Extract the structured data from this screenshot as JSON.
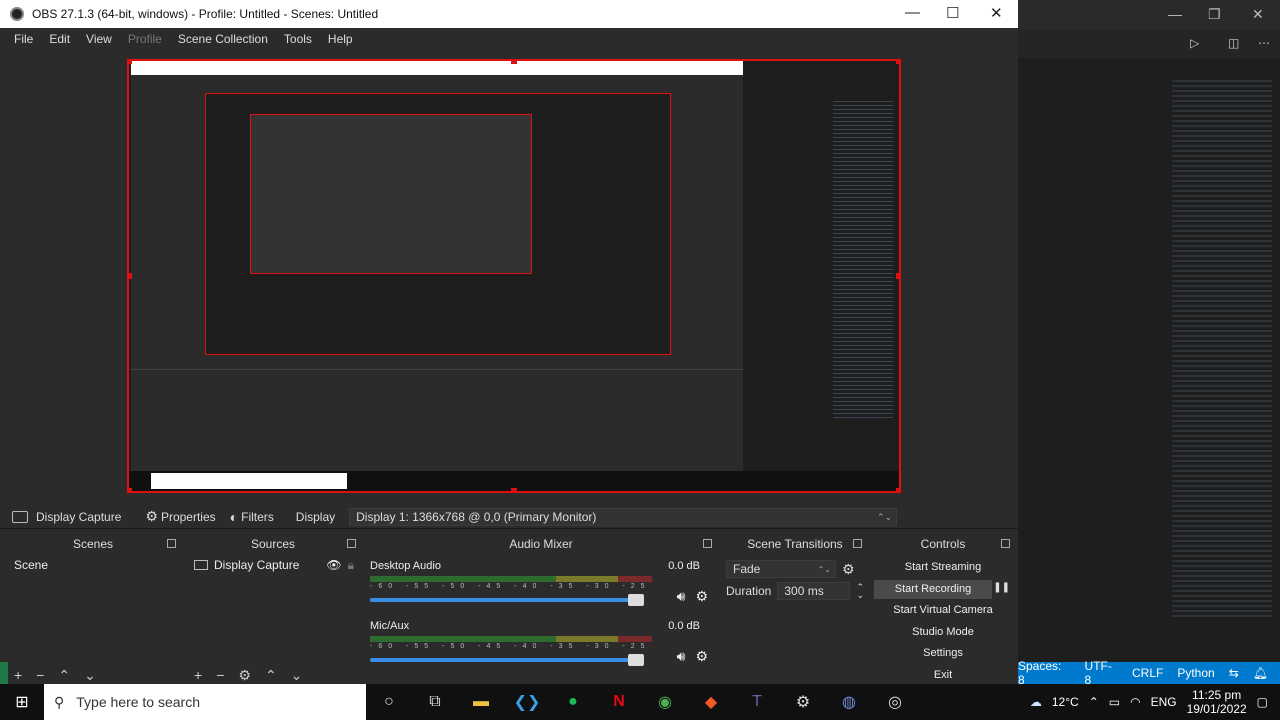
{
  "window": {
    "title": "OBS 27.1.3 (64-bit, windows) - Profile: Untitled - Scenes: Untitled"
  },
  "menu": [
    "File",
    "Edit",
    "View",
    "Profile",
    "Scene Collection",
    "Tools",
    "Help"
  ],
  "source_toolbar": {
    "source_name": "Display Capture",
    "properties": "Properties",
    "filters": "Filters",
    "display_label": "Display",
    "display_value": "Display 1: 1366x768 @ 0,0 (Primary Monitor)"
  },
  "scenes": {
    "title": "Scenes",
    "items": [
      "Scene"
    ]
  },
  "sources": {
    "title": "Sources",
    "items": [
      "Display Capture"
    ]
  },
  "mixer": {
    "title": "Audio Mixer",
    "channels": [
      {
        "name": "Desktop Audio",
        "db": "0.0 dB"
      },
      {
        "name": "Mic/Aux",
        "db": "0.0 dB"
      }
    ]
  },
  "transitions": {
    "title": "Scene Transitions",
    "selected": "Fade",
    "duration_label": "Duration",
    "duration_value": "300 ms"
  },
  "controls": {
    "title": "Controls",
    "buttons": [
      "Start Streaming",
      "Start Recording",
      "Start Virtual Camera",
      "Studio Mode",
      "Settings",
      "Exit"
    ]
  },
  "statusbar": {
    "spaces": "Spaces: 8",
    "encoding": "UTF-8",
    "eol": "CRLF",
    "lang": "Python"
  },
  "taskbar": {
    "search_placeholder": "Type here to search",
    "weather": "12°C",
    "lang": "ENG",
    "time": "11:25 pm",
    "date": "19/01/2022"
  }
}
